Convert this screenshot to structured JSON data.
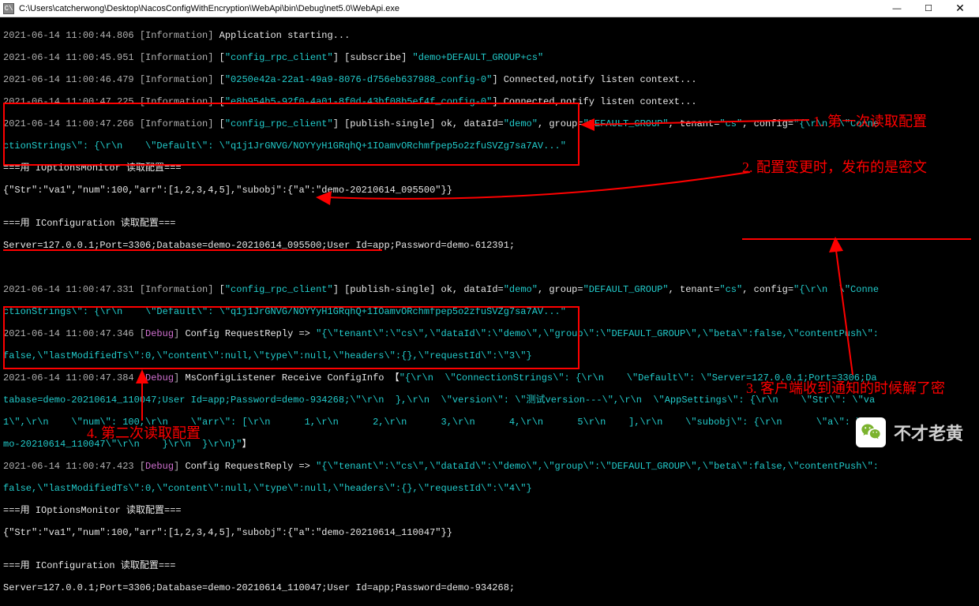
{
  "titlebar": {
    "icon_label": "C\\",
    "path": "C:\\Users\\catcherwong\\Desktop\\NacosConfigWithEncryption\\WebApi\\bin\\Debug\\net5.0\\WebApi.exe"
  },
  "window_controls": {
    "min": "—",
    "max": "☐",
    "close": "✕"
  },
  "annotations": {
    "a1": "1. 第一次读取配置",
    "a2": "2. 配置变更时，发布的是密文",
    "a3": "3. 客户端收到通知的时候解了密",
    "a4": "4. 第二次读取配置"
  },
  "watermark": {
    "text": "不才老黄"
  },
  "log": {
    "l1_ts": "2021-06-14 11:00:44.806 ",
    "l1_lvl": "[Information] ",
    "l1_msg": "Application starting...",
    "l2_ts": "2021-06-14 11:00:45.951 ",
    "l2_lvl": "[Information] ",
    "l2_b1": "[",
    "l2_c1": "\"config_rpc_client\"",
    "l2_b2": "] [subscribe] ",
    "l2_c2": "\"demo+DEFAULT_GROUP+cs\"",
    "l3_ts": "2021-06-14 11:00:46.479 ",
    "l3_lvl": "[Information] ",
    "l3_b1": "[",
    "l3_c1": "\"0250e42a-22a1-49a9-8076-d756eb637988_config-0\"",
    "l3_b2": "] Connected,notify listen context...",
    "l4_ts": "2021-06-14 11:00:47.225 ",
    "l4_lvl": "[Information] ",
    "l4_b1": "[",
    "l4_c1": "\"e8b954b5-92f0-4a01-8f0d-43bf08b5ef4f_config-0\"",
    "l4_b2": "] Connected,notify listen context...",
    "l5_ts": "2021-06-14 11:00:47.266 ",
    "l5_lvl": "[Information] ",
    "l5_b1": "[",
    "l5_c1": "\"config_rpc_client\"",
    "l5_b2": "] [publish-single] ok, dataId=",
    "l5_c2": "\"demo\"",
    "l5_b3": ", group=",
    "l5_c3": "\"DEFAULT_GROUP\"",
    "l5_b4": ", tenant=",
    "l5_c4": "\"cs\"",
    "l5_b5": ", config=",
    "l5_c5": "\"{\\r\\n  \\\"Conne",
    "l5b_cyanpre": "ctionStrings\\\": {\\r\\n    \\\"Default\\\": \\\"q1j1JrGNVG/NOYYyH1GRqhQ+1IOamvORchmfpep5o2zfuSVZg7sa7AV...\"",
    "b1_l1": "===用 IOptionsMonitor 读取配置===",
    "b1_l2": "{\"Str\":\"va1\",\"num\":100,\"arr\":[1,2,3,4,5],\"subobj\":{\"a\":\"demo-20210614_095500\"}}",
    "b1_l3": "",
    "b1_l4": "===用 IConfiguration 读取配置===",
    "b1_l5": "Server=127.0.0.1;Port=3306;Database=demo-20210614_095500;User Id=app;Password=demo-612391;",
    "l6_ts": "2021-06-14 11:00:47.331 ",
    "l6_lvl": "[Information] ",
    "l6_b1": "[",
    "l6_c1": "\"config_rpc_client\"",
    "l6_b2": "] [publish-single] ok, dataId=",
    "l6_c2": "\"demo\"",
    "l6_b3": ", group=",
    "l6_c3": "\"DEFAULT_GROUP\"",
    "l6_b4": ", tenant=",
    "l6_c4": "\"cs\"",
    "l6_b5": ", config=",
    "l6_c5": "\"{\\r\\n  \\\"Conne",
    "l6b_cyanpre": "ctionStrings\\\": {\\r\\n    \\\"Default\\\": \\\"q1j1JrGNVG/NOYYyH1GRqhQ+1IOamvORchmfpep5o2zfuSVZg7sa7AV...\"",
    "l7_ts": "2021-06-14 11:00:47.346 ",
    "l7_lvl": "[",
    "l7_dbg": "Debug",
    "l7_b1": "] ",
    "l7_msg1": "Config RequestReply => ",
    "l7_cy": "\"{\\\"tenant\\\":\\\"cs\\\",\\\"dataId\\\":\\\"demo\\\",\\\"group\\\":\\\"DEFAULT_GROUP\\\",\\\"beta\\\":false,\\\"contentPush\\\":",
    "l7b_cy": "false,\\\"lastModifiedTs\\\":0,\\\"content\\\":null,\\\"type\\\":null,\\\"headers\\\":{},\\\"requestId\\\":\\\"3\\\"}",
    "l8_ts": "2021-06-14 11:00:47.384 ",
    "l8_lvl": "[",
    "l8_dbg": "Debug",
    "l8_b1": "] ",
    "l8_msg1": "MsConfigListener Receive ConfigInfo 【",
    "l8_cy": "\"{\\r\\n  \\\"ConnectionStrings\\\": {\\r\\n    \\\"Default\\\": \\\"Server=127.0.0.1;Port=3306;Da",
    "l8b_cy": "tabase=demo-20210614_110047;User Id=app;Password=demo-934268;\\\"\\r\\n  },\\r\\n  \\\"version\\\": \\\"测试version---\\\",\\r\\n  \\\"AppSettings\\\": {\\r\\n    \\\"Str\\\": \\\"va",
    "l8c_cy": "1\\\",\\r\\n    \\\"num\\\": 100,\\r\\n    \\\"arr\\\": [\\r\\n      1,\\r\\n      2,\\r\\n      3,\\r\\n      4,\\r\\n      5\\r\\n    ],\\r\\n    \\\"subobj\\\": {\\r\\n      \\\"a\\\": \\\"de",
    "l8d_cy": "mo-20210614_110047\\\"\\r\\n    }\\r\\n  }\\r\\n}\"",
    "l8d_tail": "】",
    "l9_ts": "2021-06-14 11:00:47.423 ",
    "l9_lvl": "[",
    "l9_dbg": "Debug",
    "l9_b1": "] ",
    "l9_msg1": "Config RequestReply => ",
    "l9_cy": "\"{\\\"tenant\\\":\\\"cs\\\",\\\"dataId\\\":\\\"demo\\\",\\\"group\\\":\\\"DEFAULT_GROUP\\\",\\\"beta\\\":false,\\\"contentPush\\\":",
    "l9b_cy": "false,\\\"lastModifiedTs\\\":0,\\\"content\\\":null,\\\"type\\\":null,\\\"headers\\\":{},\\\"requestId\\\":\\\"4\\\"}",
    "b2_l1": "===用 IOptionsMonitor 读取配置===",
    "b2_l2": "{\"Str\":\"va1\",\"num\":100,\"arr\":[1,2,3,4,5],\"subobj\":{\"a\":\"demo-20210614_110047\"}}",
    "b2_l3": "",
    "b2_l4": "===用 IConfiguration 读取配置===",
    "b2_l5": "Server=127.0.0.1;Port=3306;Database=demo-20210614_110047;User Id=app;Password=demo-934268;"
  }
}
